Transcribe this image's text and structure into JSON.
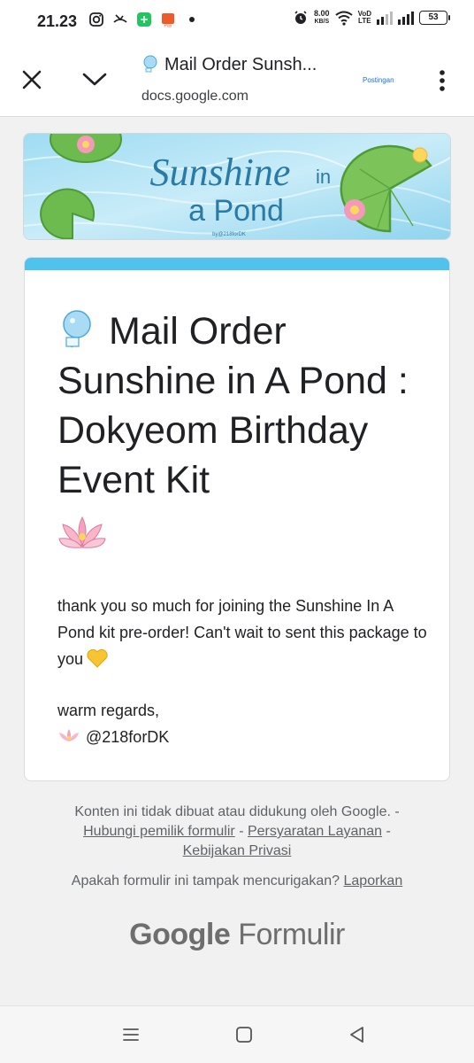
{
  "status_bar": {
    "time": "21.23",
    "left_icons": [
      "instagram-icon",
      "missed-call-icon",
      "calculator-app-icon",
      "payment-app-icon"
    ],
    "speed_value": "8.00",
    "speed_unit": "KB/S",
    "volte_top": "Vo",
    "volte_mid": "LTE",
    "volte_bot": "D",
    "battery": "53"
  },
  "tab_bar": {
    "title": "Mail Order Sunsh...",
    "url": "docs.google.com",
    "post_label": "Postingan"
  },
  "banner": {
    "title_line1": "Sunshine",
    "title_in": "in",
    "title_line2": "a Pond",
    "credit": "by@218forDK"
  },
  "form": {
    "accent_color": "#4fc3ec",
    "title": "Mail Order Sunshine in A Pond : Dokyeom Birthday Event Kit",
    "message": "thank you so much for joining the Sunshine In A Pond kit pre-order! Can't wait to sent this package to you",
    "regards": "warm regards,",
    "signature": "@218forDK"
  },
  "footer": {
    "disclaimer": "Konten ini tidak dibuat atau didukung oleh Google. -",
    "contact_link": "Hubungi pemilik formulir",
    "sep1": " - ",
    "terms_link": "Persyaratan Layanan",
    "sep2": " -",
    "privacy_link": "Kebijakan Privasi",
    "report_question": "Apakah formulir ini tampak mencurigakan?",
    "report_link": "Laporkan",
    "brand_google": "Google",
    "brand_forms": "Formulir"
  }
}
